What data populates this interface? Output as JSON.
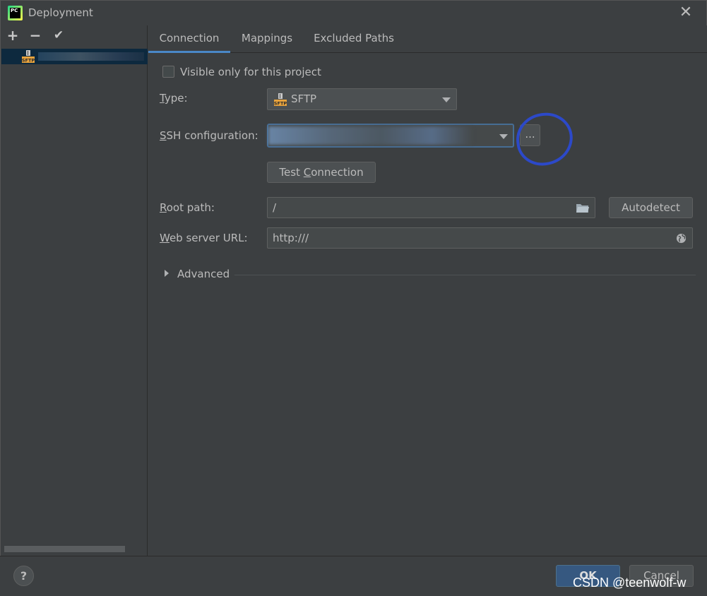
{
  "window": {
    "title": "Deployment",
    "icon_name": "pycharm-icon",
    "close_glyph": "✕"
  },
  "left": {
    "toolbar": {
      "add": "+",
      "remove": "−",
      "apply": "✔"
    },
    "server_icon_label": "SFTP"
  },
  "tabs": [
    {
      "label": "Connection",
      "active": true
    },
    {
      "label": "Mappings",
      "active": false
    },
    {
      "label": "Excluded Paths",
      "active": false
    }
  ],
  "form": {
    "visible_only_label": "Visible only for this project",
    "type_label_u": "T",
    "type_label_rest": "ype:",
    "type_value": "SFTP",
    "ssh_label_u": "S",
    "ssh_label_rest": "SH configuration:",
    "ssh_more_button": "...",
    "test_connection_pre": "Test ",
    "test_connection_u": "C",
    "test_connection_post": "onnection",
    "root_path_label_u": "R",
    "root_path_label_rest": "oot path:",
    "root_path_value": "/",
    "autodetect_label": "Autodetect",
    "web_url_label_u": "W",
    "web_url_label_rest": "eb server URL:",
    "web_url_value": "http:///",
    "advanced_label": "Advanced"
  },
  "footer": {
    "help": "?",
    "ok": "OK",
    "cancel": "Cancel",
    "watermark": "CSDN @teenwolf-w"
  },
  "colors": {
    "background": "#3c3f41",
    "accent": "#4a88c7",
    "annotation": "#2c49c9",
    "ok_button": "#365880"
  }
}
